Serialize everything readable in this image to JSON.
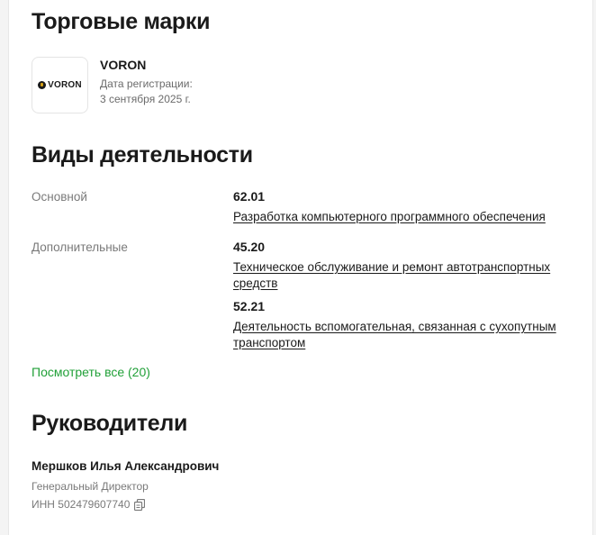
{
  "trademarks": {
    "title": "Торговые марки",
    "items": [
      {
        "logo_text": "VORON",
        "name": "VORON",
        "reg_label": "Дата регистрации:",
        "reg_date": "3 сентября 2025 г."
      }
    ]
  },
  "activities": {
    "title": "Виды деятельности",
    "main_label": "Основной",
    "main": {
      "code": "62.01",
      "name": "Разработка компьютерного программного обеспечения"
    },
    "additional_label": "Дополнительные",
    "additional": [
      {
        "code": "45.20",
        "name": "Техническое обслуживание и ремонт автотранспортных средств"
      },
      {
        "code": "52.21",
        "name": "Деятельность вспомогательная, связанная с сухопутным транспортом"
      }
    ],
    "see_all": "Посмотреть все (20)"
  },
  "managers": {
    "title": "Руководители",
    "items": [
      {
        "name": "Мершков Илья Александрович",
        "role": "Генеральный Директор",
        "inn": "ИНН 502479607740"
      }
    ]
  },
  "colors": {
    "accent_green": "#21a038",
    "text_primary": "#1a1a1a",
    "text_secondary": "#7a7a7a"
  }
}
